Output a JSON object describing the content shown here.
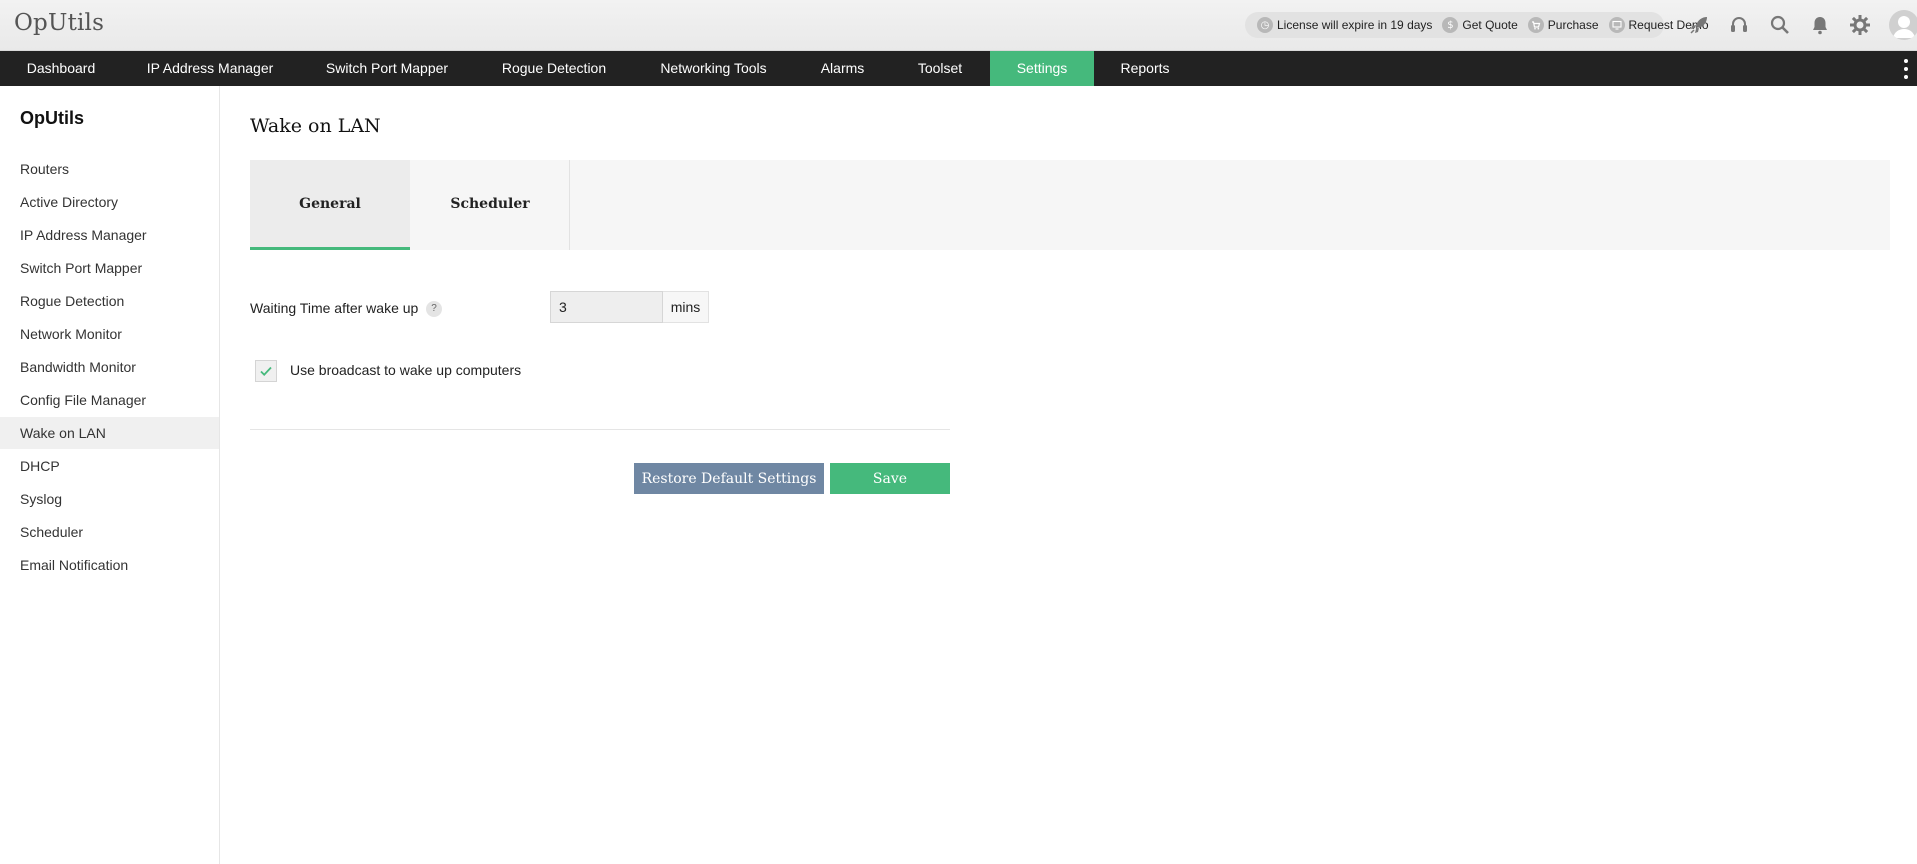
{
  "app": {
    "title": "OpUtils"
  },
  "header": {
    "license_text": "License will expire in 19 days",
    "get_quote": "Get Quote",
    "purchase": "Purchase",
    "request_demo": "Request Demo",
    "icons": [
      "rocket-icon",
      "headset-icon",
      "search-icon",
      "bell-icon",
      "gear-icon",
      "user-avatar-icon"
    ]
  },
  "nav": {
    "tabs": [
      {
        "label": "Dashboard"
      },
      {
        "label": "IP Address Manager"
      },
      {
        "label": "Switch Port Mapper"
      },
      {
        "label": "Rogue Detection"
      },
      {
        "label": "Networking Tools"
      },
      {
        "label": "Alarms"
      },
      {
        "label": "Toolset"
      },
      {
        "label": "Settings",
        "active": true
      },
      {
        "label": "Reports"
      }
    ]
  },
  "sidebar": {
    "title": "OpUtils",
    "items": [
      {
        "label": "Routers"
      },
      {
        "label": "Active Directory"
      },
      {
        "label": "IP Address Manager"
      },
      {
        "label": "Switch Port Mapper"
      },
      {
        "label": "Rogue Detection"
      },
      {
        "label": "Network Monitor"
      },
      {
        "label": "Bandwidth Monitor"
      },
      {
        "label": "Config File Manager"
      },
      {
        "label": "Wake on LAN",
        "active": true
      },
      {
        "label": "DHCP"
      },
      {
        "label": "Syslog"
      },
      {
        "label": "Scheduler"
      },
      {
        "label": "Email Notification"
      }
    ]
  },
  "main": {
    "page_title": "Wake on LAN",
    "tabs": [
      {
        "label": "General",
        "active": true
      },
      {
        "label": "Scheduler"
      }
    ],
    "waiting_label": "Waiting Time after wake up",
    "help_glyph": "?",
    "waiting_value": "3",
    "waiting_unit": "mins",
    "broadcast_label": "Use broadcast to wake up computers",
    "broadcast_checked": true,
    "restore_button": "Restore Default Settings",
    "save_button": "Save"
  },
  "colors": {
    "accent": "#45b97c",
    "nav_bg": "#222222",
    "restore_btn": "#6f87a3"
  }
}
